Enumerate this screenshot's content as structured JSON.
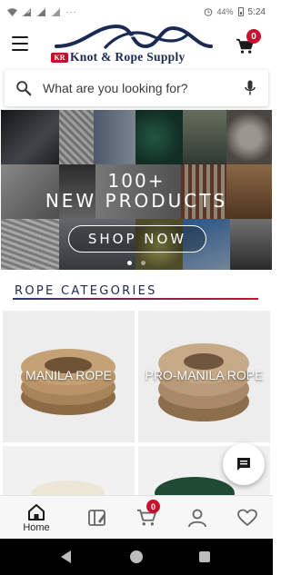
{
  "status_bar": {
    "dots": "···",
    "alarm_icon": "alarm-icon",
    "battery_percent": "44%",
    "time": "5:24"
  },
  "header": {
    "menu_icon": "hamburger-menu-icon",
    "logo_badge": "KR",
    "logo_text": "Knot & Rope Supply",
    "cart_icon": "shopping-cart-icon",
    "cart_count": "0"
  },
  "search": {
    "placeholder": "What are you looking for?",
    "value": "",
    "search_icon": "search-icon",
    "mic_icon": "microphone-icon"
  },
  "banner": {
    "line1": "100+",
    "line2": "NEW PRODUCTS",
    "cta_label": "SHOP NOW",
    "slide_count": 2,
    "active_slide": 1
  },
  "categories": {
    "title": "ROPE CATEGORIES",
    "items": [
      {
        "label": "MANILA ROPE"
      },
      {
        "label": "PRO-MANILA ROPE"
      },
      {
        "label": ""
      },
      {
        "label": ""
      }
    ]
  },
  "chat_fab": {
    "icon": "chat-message-icon"
  },
  "bottom_nav": {
    "items": [
      {
        "label": "Home",
        "icon": "home-icon"
      },
      {
        "label": "",
        "icon": "catalog-icon"
      },
      {
        "label": "",
        "icon": "cart-icon",
        "badge": "0"
      },
      {
        "label": "",
        "icon": "account-icon"
      },
      {
        "label": "",
        "icon": "wishlist-heart-icon"
      }
    ]
  },
  "colors": {
    "brand_navy": "#1b2a52",
    "brand_red": "#c8102e"
  }
}
